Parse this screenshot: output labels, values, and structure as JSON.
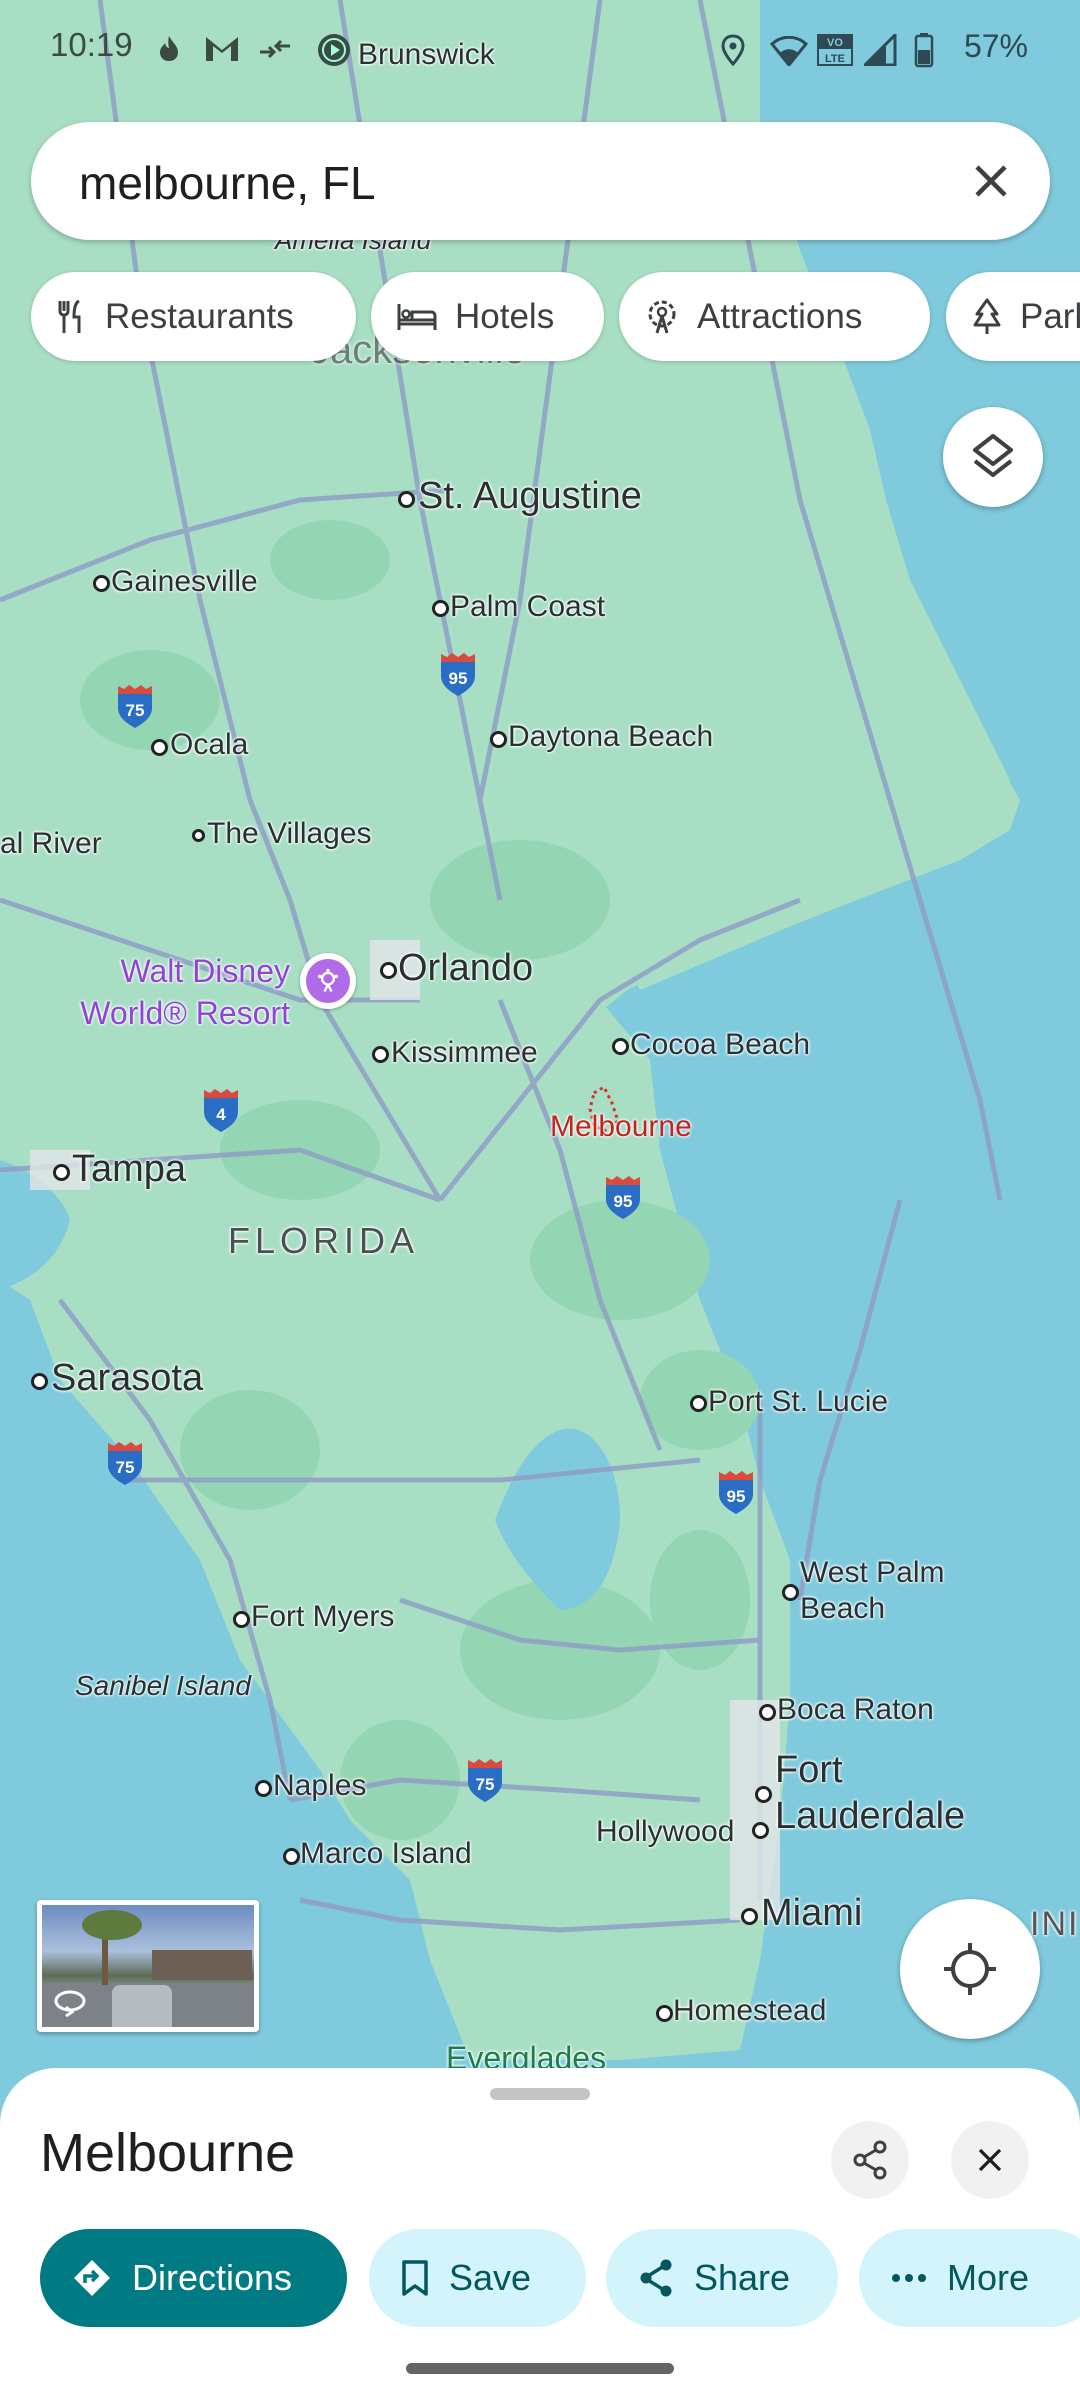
{
  "status_bar": {
    "time": "10:19",
    "map_label_behind": "Brunswick",
    "icons": [
      "fire-icon",
      "gmail-icon",
      "data-saver-icon",
      "play-circle-icon",
      "location-icon",
      "wifi-icon",
      "volte-icon",
      "signal-icon",
      "battery-icon"
    ],
    "battery_percent": "57%",
    "battery_level": 0.57
  },
  "search": {
    "query": "melbourne, FL",
    "clear_icon": "close-icon"
  },
  "chips": [
    {
      "label": "Restaurants",
      "icon": "restaurant-icon"
    },
    {
      "label": "Hotels",
      "icon": "hotel-icon"
    },
    {
      "label": "Attractions",
      "icon": "attraction-icon"
    },
    {
      "label": "Parks",
      "icon": "park-icon"
    }
  ],
  "map": {
    "colors": {
      "water": "#7fcbdd",
      "land": "#a8dfc4",
      "land_dark": "#94d6b3",
      "road": "#8f9fc4",
      "poi_purple": "#8e44d6",
      "selected_red": "#c5221f"
    },
    "region_label": "FLORIDA",
    "cities": [
      {
        "name": "Amelia Island",
        "italic": true
      },
      {
        "name": "Jacksonville"
      },
      {
        "name": "St. Augustine"
      },
      {
        "name": "Gainesville"
      },
      {
        "name": "Palm Coast"
      },
      {
        "name": "Ocala"
      },
      {
        "name": "Daytona Beach"
      },
      {
        "name": "Crystal River"
      },
      {
        "name": "The Villages"
      },
      {
        "name": "Orlando"
      },
      {
        "name": "Kissimmee"
      },
      {
        "name": "Cocoa Beach"
      },
      {
        "name": "Tampa"
      },
      {
        "name": "Sarasota"
      },
      {
        "name": "Port St. Lucie"
      },
      {
        "name": "West Palm Beach"
      },
      {
        "name": "Fort Myers"
      },
      {
        "name": "Sanibel Island",
        "italic": true
      },
      {
        "name": "Boca Raton"
      },
      {
        "name": "Naples"
      },
      {
        "name": "Fort Lauderdale"
      },
      {
        "name": "Hollywood"
      },
      {
        "name": "Marco Island"
      },
      {
        "name": "Miami"
      },
      {
        "name": "Homestead"
      },
      {
        "name": "Everglades"
      }
    ],
    "poi": {
      "name": "Walt Disney World® Resort"
    },
    "selected_place": "Melbourne",
    "highway_shields": [
      "95",
      "75",
      "4",
      "95",
      "75",
      "95",
      "75"
    ],
    "partial_label_right": "INI"
  },
  "controls": {
    "layers_icon": "layers-icon",
    "locate_icon": "my-location-icon",
    "street_view_icon": "360-rotate-icon"
  },
  "place_sheet": {
    "title": "Melbourne",
    "share_icon": "share-icon",
    "close_icon": "close-icon",
    "actions": [
      {
        "label": "Directions",
        "icon": "directions-icon",
        "style": "primary"
      },
      {
        "label": "Save",
        "icon": "bookmark-icon",
        "style": "secondary"
      },
      {
        "label": "Share",
        "icon": "share-icon",
        "style": "secondary"
      },
      {
        "label": "More",
        "icon": "more-horiz-icon",
        "style": "secondary"
      }
    ],
    "colors": {
      "primary": "#007b83",
      "secondary": "#d3f4fb",
      "secondary_text": "#04575f"
    }
  }
}
